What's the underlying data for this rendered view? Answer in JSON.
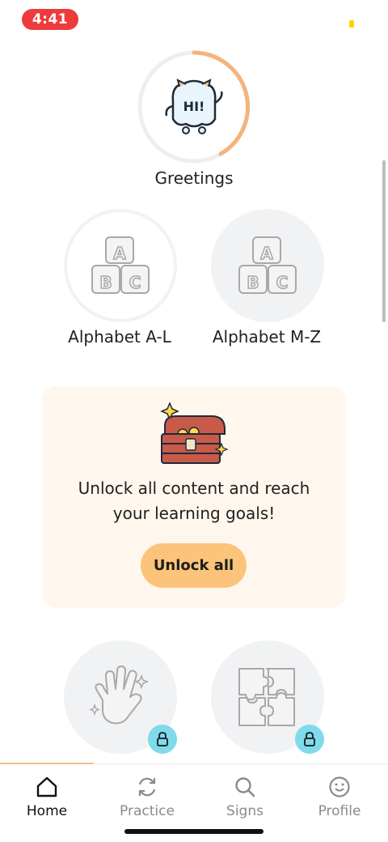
{
  "status_bar": {
    "time": "4:41"
  },
  "lessons": {
    "greetings": {
      "label": "Greetings",
      "icon": "ghost-hi-icon",
      "progress": 0.4
    },
    "alphabet_al": {
      "label": "Alphabet A-L",
      "icon": "abc-blocks-icon"
    },
    "alphabet_mz": {
      "label": "Alphabet M-Z",
      "icon": "abc-blocks-icon"
    }
  },
  "promo": {
    "line1": "Unlock all content and reach",
    "line2": "your learning goals!",
    "button_label": "Unlock all",
    "icon": "treasure-chest-icon"
  },
  "locked_lessons": [
    {
      "icon": "waving-hand-icon",
      "locked": true
    },
    {
      "icon": "puzzle-icon",
      "locked": true
    }
  ],
  "nav": {
    "items": [
      {
        "label": "Home",
        "icon": "home-icon",
        "active": true
      },
      {
        "label": "Practice",
        "icon": "refresh-icon",
        "active": false
      },
      {
        "label": "Signs",
        "icon": "search-icon",
        "active": false
      },
      {
        "label": "Profile",
        "icon": "smiley-icon",
        "active": false
      }
    ]
  },
  "colors": {
    "accent": "#f6b37c",
    "status_pill": "#ee3b3b",
    "lock_badge": "#7fdbe9",
    "button": "#fbc47a",
    "promo_bg": "#fff7ee"
  }
}
